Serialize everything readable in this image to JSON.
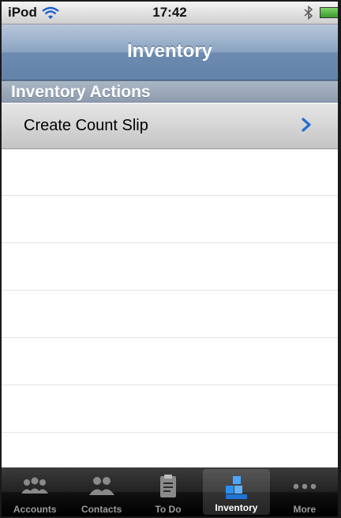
{
  "status_bar": {
    "carrier": "iPod",
    "time": "17:42"
  },
  "nav_bar": {
    "title": "Inventory"
  },
  "section": {
    "header": "Inventory Actions",
    "items": [
      {
        "label": "Create Count Slip"
      }
    ]
  },
  "tab_bar": {
    "tabs": [
      {
        "label": "Accounts",
        "icon": "accounts-icon"
      },
      {
        "label": "Contacts",
        "icon": "contacts-icon"
      },
      {
        "label": "To Do",
        "icon": "clipboard-icon"
      },
      {
        "label": "Inventory",
        "icon": "inventory-icon",
        "active": true
      },
      {
        "label": "More",
        "icon": "more-dots-icon"
      }
    ]
  },
  "colors": {
    "accent_blue": "#1f6fd0",
    "nav_bar": "#6d8bb0",
    "section_header": "#97a6b8",
    "tab_bar": "#111111"
  }
}
